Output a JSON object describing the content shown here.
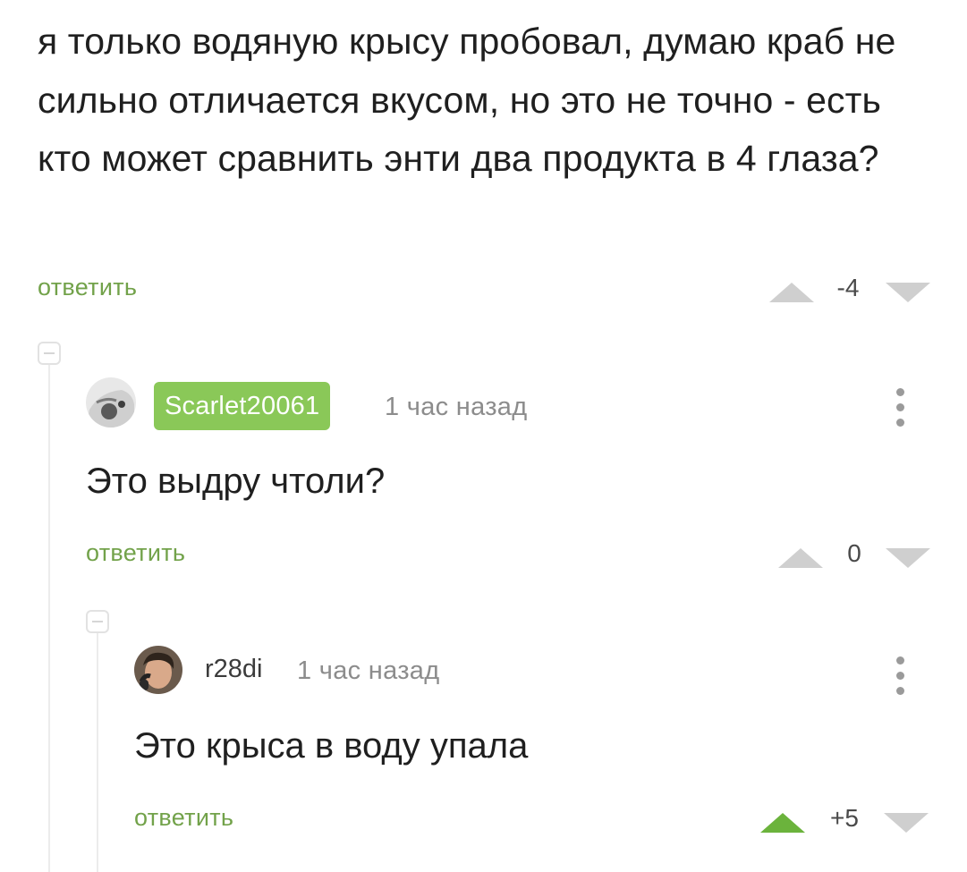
{
  "post_comment": {
    "text": "я только водяную крысу пробовал, думаю краб не сильно отличается вкусом, но это не точно - есть кто может сравнить энти два продукта в 4 глаза?",
    "reply_label": "ответить",
    "score": "-4"
  },
  "comments": [
    {
      "author": "Scarlet20061",
      "time": "1 час назад",
      "text": "Это выдру чтоли?",
      "reply_label": "ответить",
      "score": "0"
    },
    {
      "author": "r28di",
      "time": "1 час назад",
      "text": "Это крыса в воду упала",
      "reply_label": "ответить",
      "score": "+5"
    }
  ],
  "colors": {
    "accent_green": "#72a24a",
    "badge_green": "#8ac858",
    "upvote_active": "#6bb33c",
    "vote_inactive": "#cfcfcf"
  },
  "icons": {
    "upvote": "triangle-up-icon",
    "downvote": "triangle-down-icon",
    "more": "vertical-dots-icon",
    "collapse": "minus-box-icon"
  }
}
